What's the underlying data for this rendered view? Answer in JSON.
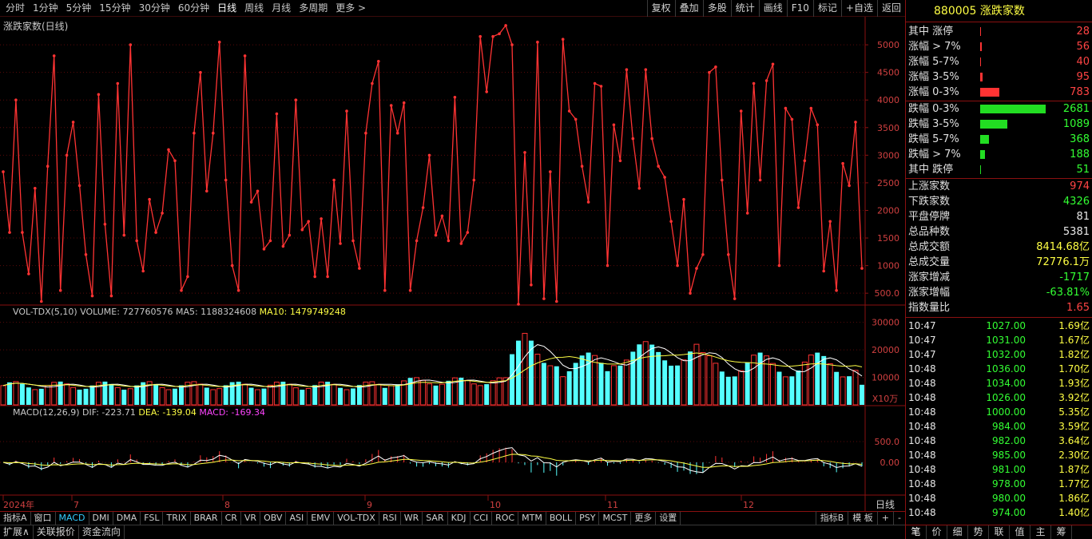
{
  "toolbar": {
    "periods": [
      "分时",
      "1分钟",
      "5分钟",
      "15分钟",
      "30分钟",
      "60分钟",
      "日线",
      "周线",
      "月线",
      "多周期",
      "更多 >"
    ],
    "active_period": "日线",
    "tools": [
      "复权",
      "叠加",
      "多股",
      "统计",
      "画线",
      "F10",
      "标记",
      "+自选",
      "返回"
    ]
  },
  "main_chart": {
    "title": "涨跌家数(日线)",
    "line_color": "#ff3333",
    "y_ticks": [
      "5000",
      "4500",
      "4000",
      "3500",
      "3000",
      "2500",
      "2000",
      "1500",
      "1000",
      "500.0"
    ]
  },
  "volume_chart": {
    "title": "VOL-TDX(5,10)",
    "volume_label": "VOLUME: 727760576",
    "ma5_label": "MA5: 1188324608",
    "ma10_label": "MA10: 1479749248",
    "y_ticks": [
      "30000",
      "20000",
      "10000"
    ],
    "unit": "X10万"
  },
  "macd_chart": {
    "title": "MACD(12,26,9)",
    "dif_label": "DIF: -223.71",
    "dea_label": "DEA: -139.04",
    "macd_label": "MACD: -169.34",
    "y_ticks": [
      "500.0",
      "0.00"
    ]
  },
  "x_axis": {
    "labels": [
      "2024年",
      "7",
      "8",
      "9",
      "10",
      "11",
      "12"
    ],
    "period_label": "日线"
  },
  "chart_data": {
    "type": "line",
    "title": "涨跌家数(日线)",
    "y_range": [
      300,
      5450
    ],
    "series": [
      {
        "name": "涨跌家数",
        "values": [
          2700,
          1600,
          4000,
          1600,
          850,
          2400,
          350,
          2800,
          4800,
          550,
          3000,
          3600,
          2450,
          1200,
          450,
          4100,
          1750,
          450,
          4300,
          1550,
          5000,
          1450,
          900,
          2200,
          1600,
          1950,
          3100,
          2900,
          550,
          800,
          3400,
          4500,
          2350,
          3400,
          5050,
          2550,
          1000,
          550,
          4800,
          2150,
          2350,
          1300,
          1450,
          3750,
          1350,
          1550,
          4000,
          1650,
          1800,
          800,
          1850,
          800,
          2550,
          1400,
          3800,
          1450,
          950,
          3400,
          4300,
          4700,
          550,
          3900,
          3400,
          3950,
          550,
          1450,
          2050,
          3000,
          1550,
          1900,
          1450,
          4050,
          1400,
          1600,
          2550,
          5150,
          4150,
          5150,
          5200,
          5350,
          5000,
          300,
          3050,
          650,
          5050,
          400,
          2700,
          350,
          5100,
          3800,
          3650,
          2800,
          2150,
          4300,
          4250,
          1000,
          3550,
          2900,
          4550,
          3300,
          2400,
          4550,
          3300,
          2800,
          2600,
          1800,
          1000,
          2200,
          500,
          950,
          1200,
          4500,
          4600,
          2550,
          1200,
          400,
          3800,
          1950,
          4300,
          2550,
          4350,
          4650,
          1000,
          3850,
          3650,
          2050,
          2900,
          3850,
          3550,
          900,
          1800,
          550,
          2850,
          2450,
          3600,
          950
        ]
      }
    ]
  },
  "right_panel": {
    "title": "880005 涨跌家数",
    "up_rows": [
      {
        "label": "其中 涨停",
        "value": "28",
        "frac": 0.0
      },
      {
        "label": "涨幅 > 7%",
        "value": "56",
        "frac": 0.02
      },
      {
        "label": "涨幅 5-7%",
        "value": "40",
        "frac": 0.015
      },
      {
        "label": "涨幅 3-5%",
        "value": "95",
        "frac": 0.035
      },
      {
        "label": "涨幅 0-3%",
        "value": "783",
        "frac": 0.29
      }
    ],
    "down_rows": [
      {
        "label": "跌幅 0-3%",
        "value": "2681",
        "frac": 1.0
      },
      {
        "label": "跌幅 3-5%",
        "value": "1089",
        "frac": 0.41
      },
      {
        "label": "跌幅 5-7%",
        "value": "368",
        "frac": 0.14
      },
      {
        "label": "跌幅 > 7%",
        "value": "188",
        "frac": 0.07
      },
      {
        "label": "其中 跌停",
        "value": "51",
        "frac": 0.0
      }
    ],
    "stats": [
      {
        "label": "上涨家数",
        "value": "974",
        "color": "#ff4444"
      },
      {
        "label": "下跌家数",
        "value": "4326",
        "color": "#33ff33"
      },
      {
        "label": "平盘停牌",
        "value": "81",
        "color": "#e8e8e8"
      },
      {
        "label": "总品种数",
        "value": "5381",
        "color": "#e8e8e8"
      },
      {
        "label": "总成交额",
        "value": "8414.68亿",
        "color": "#ffff44"
      },
      {
        "label": "总成交量",
        "value": "72776.1万",
        "color": "#ffff44"
      },
      {
        "label": "涨家增减",
        "value": "-1717",
        "color": "#33ff33"
      },
      {
        "label": "涨家增幅",
        "value": "-63.81%",
        "color": "#33ff33"
      },
      {
        "label": "指数量比",
        "value": "1.65",
        "color": "#ff4444"
      }
    ],
    "ticks": [
      {
        "time": "10:47",
        "price": "1027.00",
        "amount": "1.69亿"
      },
      {
        "time": "10:47",
        "price": "1031.00",
        "amount": "1.67亿"
      },
      {
        "time": "10:47",
        "price": "1032.00",
        "amount": "1.82亿"
      },
      {
        "time": "10:48",
        "price": "1036.00",
        "amount": "1.70亿"
      },
      {
        "time": "10:48",
        "price": "1034.00",
        "amount": "1.93亿"
      },
      {
        "time": "10:48",
        "price": "1026.00",
        "amount": "3.92亿"
      },
      {
        "time": "10:48",
        "price": "1000.00",
        "amount": "5.35亿"
      },
      {
        "time": "10:48",
        "price": "984.00",
        "amount": "3.59亿"
      },
      {
        "time": "10:48",
        "price": "982.00",
        "amount": "3.64亿"
      },
      {
        "time": "10:48",
        "price": "985.00",
        "amount": "2.30亿"
      },
      {
        "time": "10:48",
        "price": "981.00",
        "amount": "1.87亿"
      },
      {
        "time": "10:48",
        "price": "978.00",
        "amount": "1.77亿"
      },
      {
        "time": "10:48",
        "price": "980.00",
        "amount": "1.86亿"
      },
      {
        "time": "10:48",
        "price": "974.00",
        "amount": "1.40亿"
      }
    ],
    "bottom_tabs": [
      "笔",
      "价",
      "细",
      "势",
      "联",
      "值",
      "主",
      "筹"
    ]
  },
  "indicator_tabs": [
    "指标A",
    "窗口",
    "MACD",
    "DMI",
    "DMA",
    "FSL",
    "TRIX",
    "BRAR",
    "CR",
    "VR",
    "OBV",
    "ASI",
    "EMV",
    "VOL-TDX",
    "RSI",
    "WR",
    "SAR",
    "KDJ",
    "CCI",
    "ROC",
    "MTM",
    "BOLL",
    "PSY",
    "MCST",
    "更多",
    "设置"
  ],
  "active_indicator": "MACD",
  "indicator_tabs_right": [
    "指标B",
    "模 板",
    "+",
    "-"
  ],
  "status_tabs": [
    "扩展∧",
    "关联报价",
    "资金流向"
  ],
  "colors": {
    "up": "#ff3333",
    "down": "#55ffff",
    "grid": "#8a1010",
    "ma5": "#ffffff",
    "ma10": "#ffff44"
  }
}
